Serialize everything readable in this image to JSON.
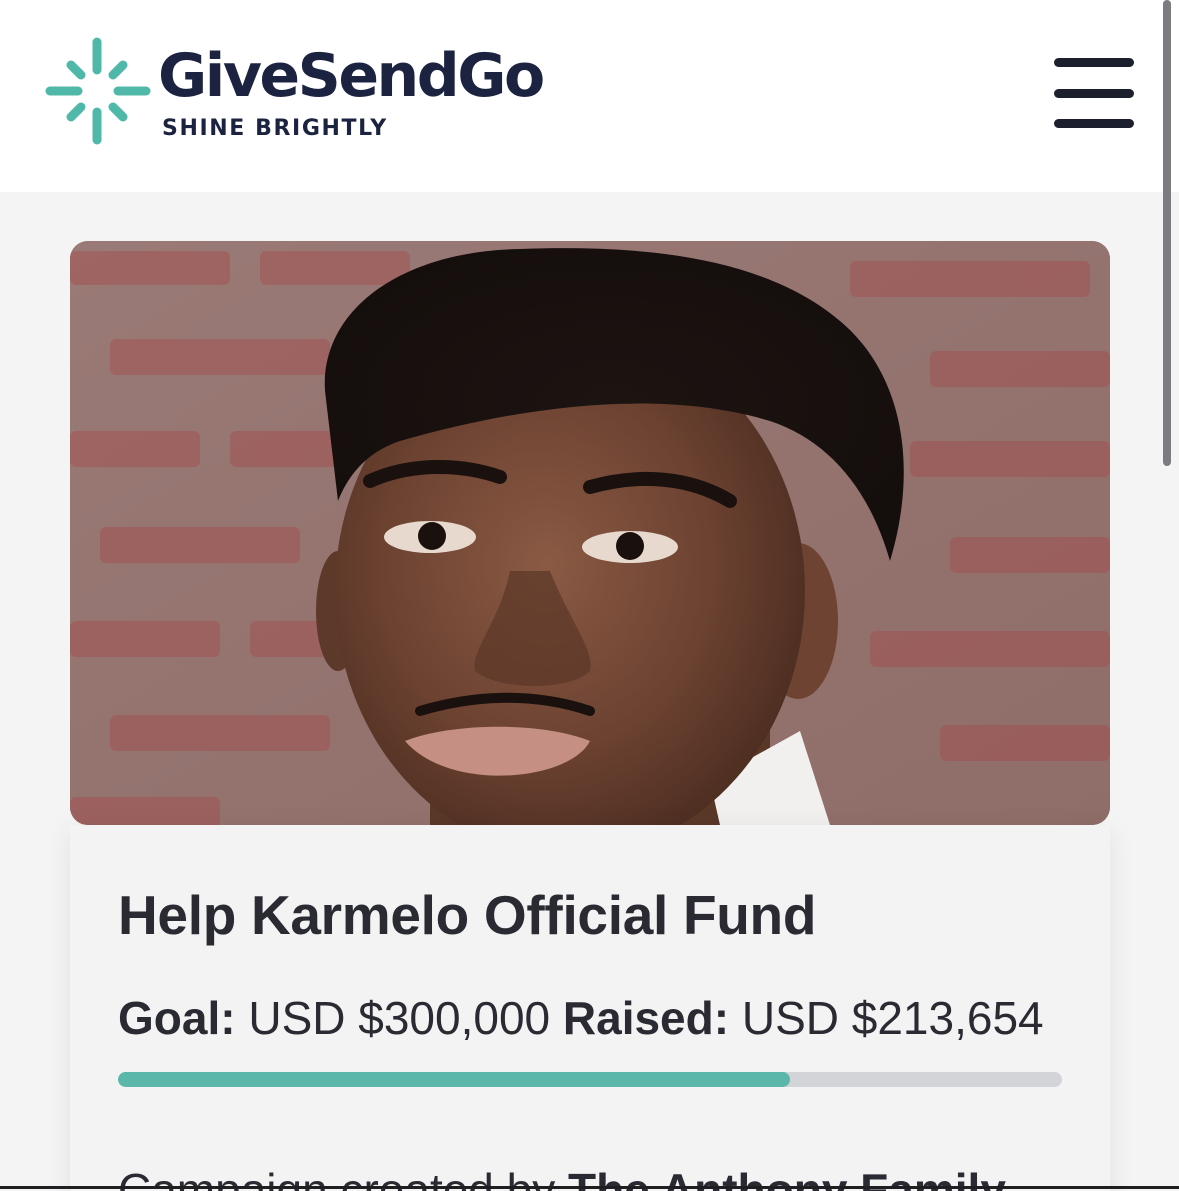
{
  "header": {
    "brand_name": "GiveSendGo",
    "tagline": "SHINE BRIGHTLY",
    "logo_icon": "sparkle-logo-icon",
    "menu_icon": "hamburger-menu-icon"
  },
  "hero": {
    "image": "portrait-photo"
  },
  "campaign": {
    "title": "Help Karmelo Official Fund",
    "goal_label": "Goal:",
    "goal_value": "USD $300,000",
    "raised_label": "Raised:",
    "raised_value": "USD $213,654",
    "progress_fraction": 0.712,
    "creator_prefix": "Campaign created by",
    "creator_name": "The Anthony Family"
  },
  "colors": {
    "brand_teal": "#4fb8a8",
    "brand_navy": "#1b2340",
    "progress_fill": "#5bb7aa",
    "progress_track": "#d3d4d7"
  }
}
